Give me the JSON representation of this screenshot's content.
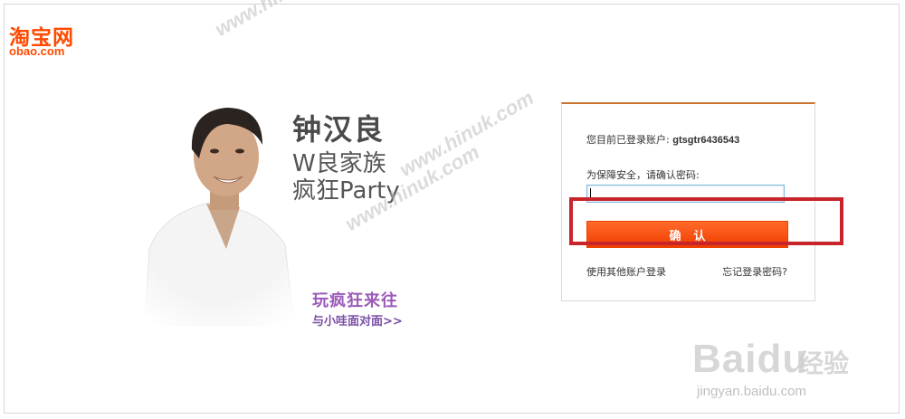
{
  "logo": {
    "cn": "淘宝网",
    "en": "obao.com"
  },
  "promo": {
    "line1": "钟汉良",
    "line2": "W良家族",
    "line3": "疯狂Party",
    "line4": "玩疯狂来往",
    "line5": "与小哇面对面>>"
  },
  "login": {
    "account_label": "您目前已登录账户:",
    "account_name": "gtsgtr6436543",
    "security_prompt": "为保障安全，请确认密码:",
    "password_value": "",
    "confirm_label": "确认",
    "other_account_link": "使用其他账户登录",
    "forgot_password_link": "忘记登录密码?"
  },
  "watermarks": {
    "site1": "www.hinuk.com",
    "site2": "www.hinuk.com",
    "site3": "www.hinuk.com",
    "baidu_logo": "Baidu",
    "baidu_cn": "经验",
    "baidu_url": "jingyan.baidu.com"
  },
  "colors": {
    "brand": "#ff4a00",
    "button": "#f04a00",
    "highlight": "#c8242b",
    "promo_purple": "#9b5ab8"
  }
}
